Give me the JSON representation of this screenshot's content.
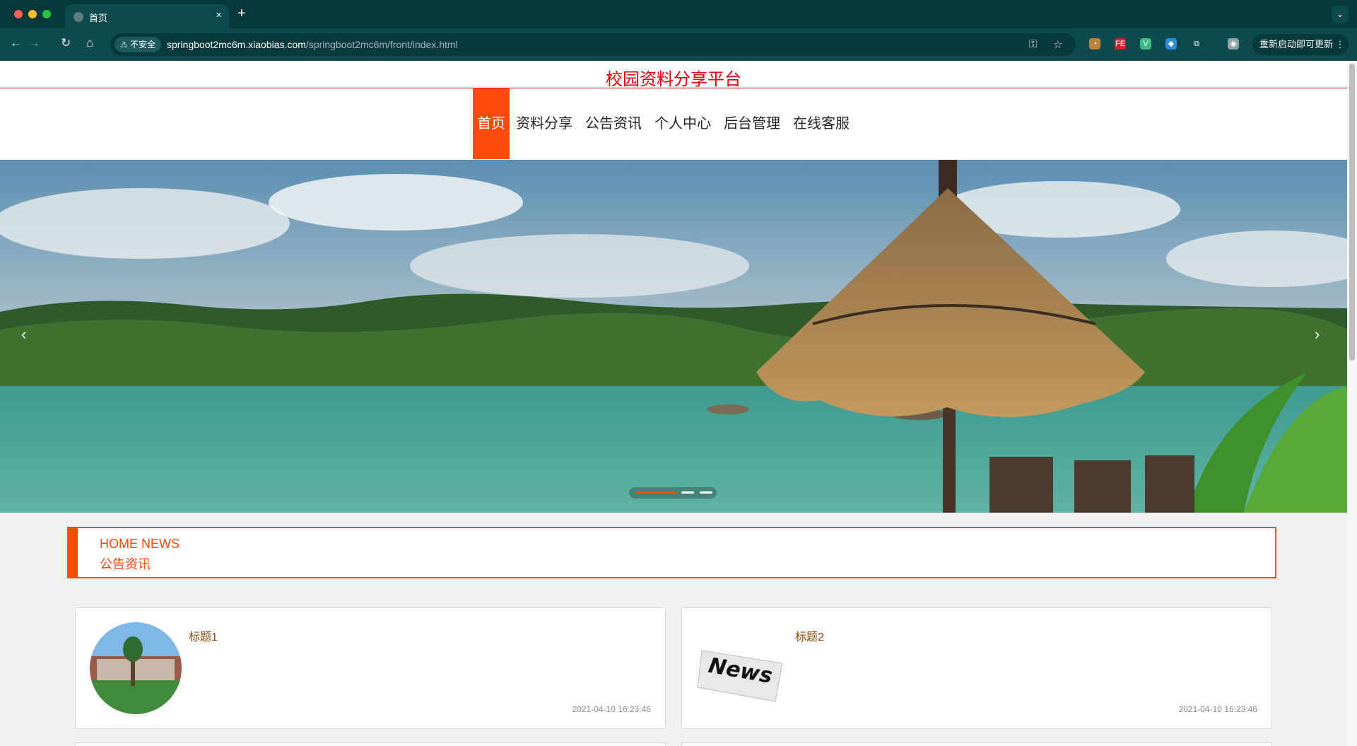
{
  "browser": {
    "tab_title": "首页",
    "tab_close": "×",
    "new_tab": "+",
    "tab_menu": "⌄",
    "back": "←",
    "forward": "→",
    "reload": "↻",
    "home": "⌂",
    "security_label": "⚠ 不安全",
    "url_host": "springboot2mc6m.xiaobias.com",
    "url_path": "/springboot2mc6m/front/index.html",
    "key_icon": "⚿",
    "star_icon": "☆",
    "relaunch_label": "重新启动即可更新 ⋮",
    "extensions": [
      {
        "name": "cookie-extension-icon",
        "label": "◔",
        "color": "#c2803b"
      },
      {
        "name": "fe-extension-icon",
        "label": "FE",
        "color": "#d1242f"
      },
      {
        "name": "vue-extension-icon",
        "label": "V",
        "color": "#41b883"
      },
      {
        "name": "gem-extension-icon",
        "label": "◆",
        "color": "#2f8bd9"
      },
      {
        "name": "puzzle-extension-icon",
        "label": "⧉",
        "color": "#0e4a4f"
      },
      {
        "name": "profile-avatar-icon",
        "label": "◉",
        "color": "#8fa1a3"
      }
    ]
  },
  "site": {
    "title": "校园资料分享平台",
    "menu": [
      {
        "label": "首页",
        "active": true
      },
      {
        "label": "资料分享",
        "active": false
      },
      {
        "label": "公告资讯",
        "active": false
      },
      {
        "label": "个人中心",
        "active": false
      },
      {
        "label": "后台管理",
        "active": false
      },
      {
        "label": "在线客服",
        "active": false
      }
    ]
  },
  "carousel": {
    "prev": "‹",
    "next": "›",
    "slide_count": 3,
    "active_index": 0
  },
  "news": {
    "heading_en": "HOME NEWS",
    "heading_cn": "公告资讯",
    "items": [
      {
        "title": "标题1",
        "date": "2021-04-10 16:23:46",
        "image": "campus-building"
      },
      {
        "title": "标题2",
        "date": "2021-04-10 16:23:46",
        "image": "newspaper"
      }
    ]
  },
  "colors": {
    "accent": "#ff4a0a",
    "site_title": "#e3000b",
    "browser_frame": "#0e4a4f"
  }
}
